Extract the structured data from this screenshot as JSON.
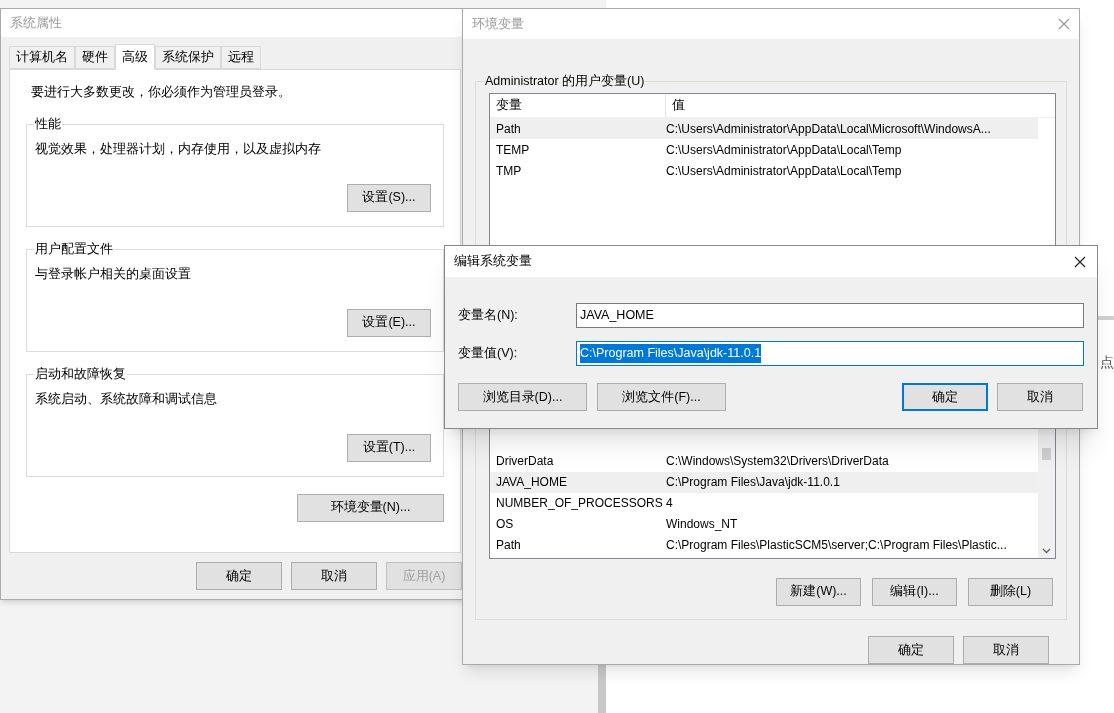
{
  "system_properties": {
    "title": "系统属性",
    "tabs": [
      {
        "label": "计算机名",
        "selected": false
      },
      {
        "label": "硬件",
        "selected": false
      },
      {
        "label": "高级",
        "selected": true
      },
      {
        "label": "系统保护",
        "selected": false
      },
      {
        "label": "远程",
        "selected": false
      }
    ],
    "notice": "要进行大多数更改，你必须作为管理员登录。",
    "groups": [
      {
        "title": "性能",
        "description": "视觉效果，处理器计划，内存使用，以及虚拟内存",
        "button": "设置(S)..."
      },
      {
        "title": "用户配置文件",
        "description": "与登录帐户相关的桌面设置",
        "button": "设置(E)..."
      },
      {
        "title": "启动和故障恢复",
        "description": "系统启动、系统故障和调试信息",
        "button": "设置(T)..."
      }
    ],
    "env_button": "环境变量(N)...",
    "footer_buttons": [
      {
        "label": "确定",
        "disabled": false
      },
      {
        "label": "取消",
        "disabled": false
      },
      {
        "label": "应用(A)",
        "disabled": true
      }
    ]
  },
  "environment_variables": {
    "title": "环境变量",
    "user_group_title": "Administrator 的用户变量(U)",
    "user_table": {
      "columns": [
        "变量",
        "值"
      ],
      "rows": [
        {
          "name": "Path",
          "value": "C:\\Users\\Administrator\\AppData\\Local\\Microsoft\\WindowsA...",
          "selected": true
        },
        {
          "name": "TEMP",
          "value": "C:\\Users\\Administrator\\AppData\\Local\\Temp",
          "selected": false
        },
        {
          "name": "TMP",
          "value": "C:\\Users\\Administrator\\AppData\\Local\\Temp",
          "selected": false
        }
      ]
    },
    "system_table": {
      "rows": [
        {
          "name": "DriverData",
          "value": "C:\\Windows\\System32\\Drivers\\DriverData",
          "selected": false
        },
        {
          "name": "JAVA_HOME",
          "value": "C:\\Program Files\\Java\\jdk-11.0.1",
          "selected": true
        },
        {
          "name": "NUMBER_OF_PROCESSORS",
          "value": "4",
          "selected": false
        },
        {
          "name": "OS",
          "value": "Windows_NT",
          "selected": false
        },
        {
          "name": "Path",
          "value": "C:\\Program Files\\PlasticSCM5\\server;C:\\Program Files\\Plastic...",
          "selected": false
        }
      ]
    },
    "system_buttons": [
      "新建(W)...",
      "编辑(I)...",
      "删除(L)"
    ],
    "footer_buttons": [
      "确定",
      "取消"
    ]
  },
  "edit_dialog": {
    "title": "编辑系统变量",
    "fields": [
      {
        "label": "变量名(N):",
        "value": "JAVA_HOME",
        "selected": false
      },
      {
        "label": "变量值(V):",
        "value": "C:\\Program Files\\Java\\jdk-11.0.1",
        "selected": true
      }
    ],
    "buttons": [
      {
        "label": "浏览目录(D)...",
        "default": false
      },
      {
        "label": "浏览文件(F)...",
        "default": false
      },
      {
        "label": "确定",
        "default": true
      },
      {
        "label": "取消",
        "default": false
      }
    ]
  },
  "background_text": "点"
}
